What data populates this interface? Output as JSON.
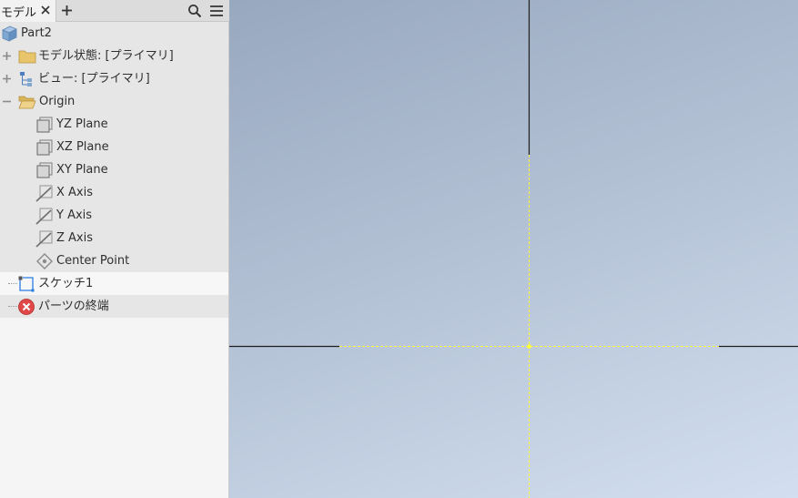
{
  "tab": {
    "label": "モデル"
  },
  "tree": {
    "part": "Part2",
    "model_state": "モデル状態: [プライマリ]",
    "view": "ビュー: [プライマリ]",
    "origin": "Origin",
    "yz_plane": "YZ Plane",
    "xz_plane": "XZ Plane",
    "xy_plane": "XY Plane",
    "x_axis": "X Axis",
    "y_axis": "Y Axis",
    "z_axis": "Z Axis",
    "center_point": "Center Point",
    "sketch": "スケッチ1",
    "end_of_part": "パーツの終端"
  },
  "colors": {
    "folder": "#e8c46a",
    "part_icon": "#7fa7d0",
    "sketch_icon": "#2a7de1",
    "end_icon": "#e04848",
    "axis_highlight": "#ffff33",
    "axis_dark": "#1e1e1e"
  }
}
